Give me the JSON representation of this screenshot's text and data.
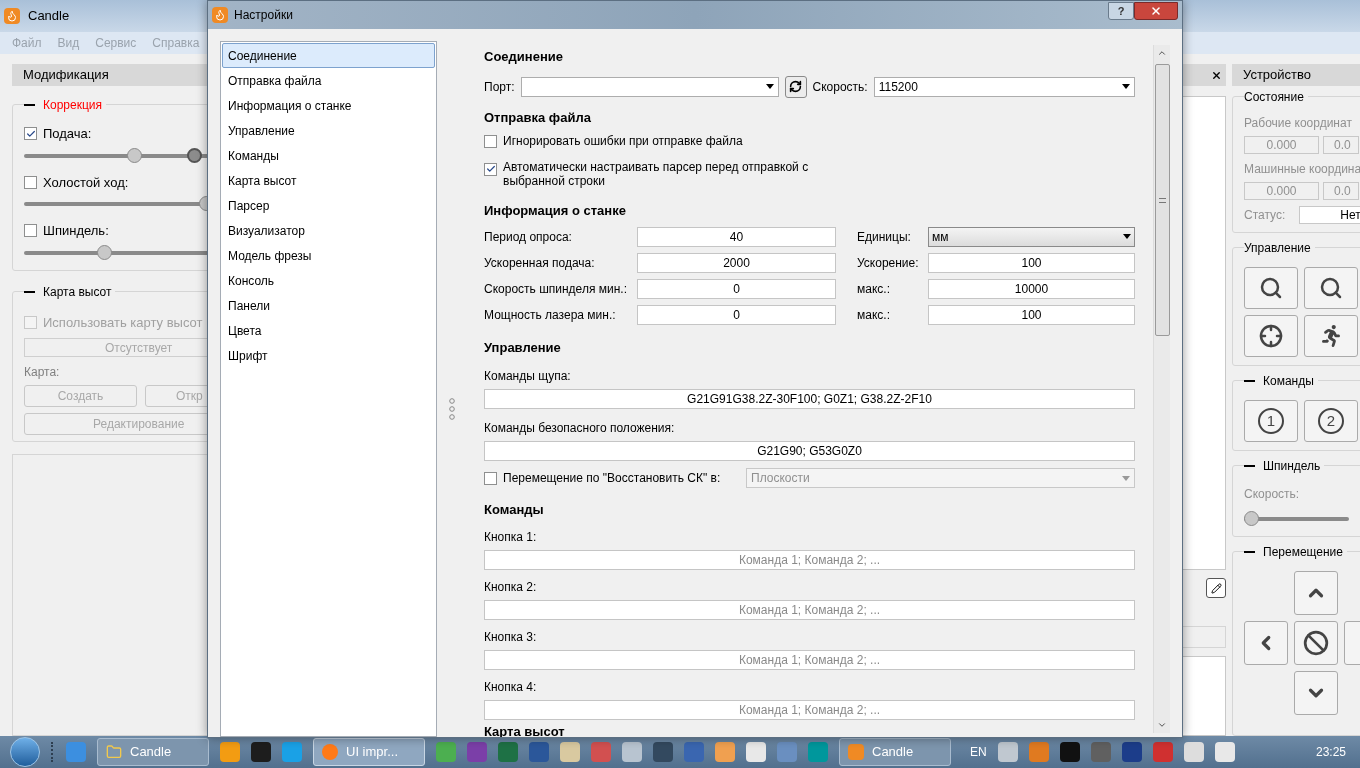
{
  "main_window": {
    "title": "Candle",
    "menu": [
      "Файл",
      "Вид",
      "Сервис",
      "Справка"
    ]
  },
  "left_panel": {
    "title": "Модификация",
    "correction": {
      "title": "Коррекция",
      "items": [
        {
          "label": "Подача:",
          "checked": true,
          "sliders": [
            {
              "level": 0.59
            },
            {
              "level": 0.93
            }
          ]
        },
        {
          "label": "Холостой ход:",
          "checked": false,
          "sliders": [
            {
              "level": 1
            }
          ]
        },
        {
          "label": "Шпиндель:",
          "checked": false,
          "sliders": [
            {
              "level": 0.42
            }
          ]
        }
      ]
    },
    "heightmap": {
      "title": "Карта высот",
      "use_label": "Использовать карту высот",
      "use_checked": false,
      "status": "Отсутствует",
      "map_label": "Карта:",
      "buttons": [
        "Создать",
        "Откр"
      ],
      "edit_button": "Редактирование"
    }
  },
  "right_panel": {
    "title": "Устройство",
    "state": {
      "title": "Состояние",
      "work_label": "Рабочие координат",
      "work": [
        "0.000",
        "0.0"
      ],
      "machine_label": "Машинные координа",
      "machine": [
        "0.000",
        "0.0"
      ],
      "status_label": "Статус:",
      "status": "Нет"
    },
    "control": {
      "title": "Управление"
    },
    "commands": {
      "title": "Команды",
      "buttons": [
        "1",
        "2"
      ]
    },
    "spindle": {
      "title": "Шпиндель",
      "speed_label": "Скорость:",
      "level": 0
    },
    "jog": {
      "title": "Перемещение"
    }
  },
  "dialog": {
    "title": "Настройки",
    "help": "?",
    "nav": [
      {
        "label": "Соединение",
        "selected": true
      },
      {
        "label": "Отправка файла",
        "selected": false
      },
      {
        "label": "Информация о станке",
        "selected": false
      },
      {
        "label": "Управление",
        "selected": false
      },
      {
        "label": "Команды",
        "selected": false
      },
      {
        "label": "Карта высот",
        "selected": false
      },
      {
        "label": "Парсер",
        "selected": false
      },
      {
        "label": "Визуализатор",
        "selected": false
      },
      {
        "label": "Модель фрезы",
        "selected": false
      },
      {
        "label": "Консоль",
        "selected": false
      },
      {
        "label": "Панели",
        "selected": false
      },
      {
        "label": "Цвета",
        "selected": false
      },
      {
        "label": "Шрифт",
        "selected": false
      }
    ],
    "connection": {
      "title": "Соединение",
      "port_label": "Порт:",
      "speed_label": "Скорость:",
      "speed": "115200"
    },
    "sending": {
      "title": "Отправка файла",
      "options": [
        {
          "label": "Игнорировать ошибки при отправке файла",
          "checked": false
        },
        {
          "label": "Автоматически настраивать парсер перед отправкой с выбранной строки",
          "checked": true
        }
      ]
    },
    "machine": {
      "title": "Информация о станке",
      "rows": [
        {
          "label": "Период опроса:",
          "value": "40",
          "right": {
            "label": "Единицы:",
            "value": "мм",
            "kind": "select"
          }
        },
        {
          "label": "Ускоренная подача:",
          "value": "2000",
          "right": {
            "label": "Ускорение:",
            "value": "100",
            "kind": "field"
          }
        },
        {
          "label": "Скорость шпинделя мин.:",
          "value": "0",
          "right": {
            "label": "макс.:",
            "value": "10000",
            "kind": "field"
          }
        },
        {
          "label": "Мощность лазера мин.:",
          "value": "0",
          "right": {
            "label": "макс.:",
            "value": "100",
            "kind": "field"
          }
        }
      ]
    },
    "control": {
      "title": "Управление",
      "probe_label": "Команды щупа:",
      "probe": "G21G91G38.2Z-30F100; G0Z1; G38.2Z-2F10",
      "safe_label": "Команды безопасного положения:",
      "safe": "G21G90; G53G0Z0",
      "restore_label": "Перемещение по \"Восстановить СК\" в:",
      "restore_checked": false,
      "restore_value": "Плоскости"
    },
    "commands": {
      "title": "Команды",
      "buttons": [
        {
          "label": "Кнопка 1:",
          "placeholder": "Команда 1; Команда 2; ..."
        },
        {
          "label": "Кнопка 2:",
          "placeholder": "Команда 1; Команда 2; ..."
        },
        {
          "label": "Кнопка 3:",
          "placeholder": "Команда 1; Команда 2; ..."
        },
        {
          "label": "Кнопка 4:",
          "placeholder": "Команда 1; Команда 2; ..."
        }
      ]
    },
    "next_title": "Карта высот"
  },
  "taskbar": {
    "buttons": [
      {
        "label": "Candle",
        "selected": false
      },
      {
        "label": "UI impr...",
        "selected": true
      },
      {
        "label": "Candle",
        "selected": false
      }
    ],
    "language": "EN",
    "clock": "23:25"
  }
}
